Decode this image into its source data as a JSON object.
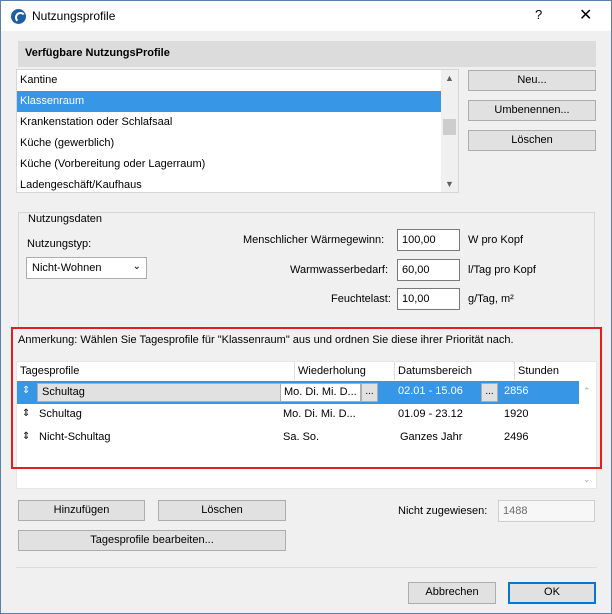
{
  "window": {
    "title": "Nutzungsprofile",
    "help_label": "?",
    "close_label": "✕"
  },
  "profiles": {
    "header": "Verfügbare NutzungsProfile",
    "items": [
      "Kantine",
      "Klassenraum",
      "Krankenstation oder Schlafsaal",
      "Küche (gewerblich)",
      "Küche (Vorbereitung oder Lagerraum)",
      "Ladengeschäft/Kaufhaus"
    ],
    "selected": "Klassenraum",
    "new_label": "Neu...",
    "rename_label": "Umbenennen...",
    "delete_label": "Löschen"
  },
  "usage_data": {
    "legend": "Nutzungsdaten",
    "type_label": "Nutzungstyp:",
    "type_value": "Nicht-Wohnen",
    "heat_gain_label": "Menschlicher Wärmegewinn:",
    "heat_gain_value": "100,00",
    "heat_gain_unit": "W pro Kopf",
    "hot_water_label": "Warmwasserbedarf:",
    "hot_water_value": "60,00",
    "hot_water_unit": "l/Tag pro Kopf",
    "moisture_label": "Feuchtelast:",
    "moisture_value": "10,00",
    "moisture_unit": "g/Tag, m²"
  },
  "day_profiles": {
    "note": "Anmerkung: Wählen Sie Tagesprofile für \"Klassenraum\" aus und ordnen Sie diese ihrer Priorität nach.",
    "columns": [
      "Tagesprofile",
      "Wiederholung",
      "Datumsbereich",
      "Stunden"
    ],
    "rows": [
      {
        "profile": "Schultag",
        "repeat": "Mo. Di. Mi. D...",
        "date_range": "02.01 - 15.06",
        "hours": "2856",
        "selected": true
      },
      {
        "profile": "Schultag",
        "repeat": "Mo. Di. Mi. D...",
        "date_range": "01.09 - 23.12",
        "hours": "1920",
        "selected": false
      },
      {
        "profile": "Nicht-Schultag",
        "repeat": "Sa. So.",
        "date_range": "Ganzes Jahr",
        "hours": "2496",
        "selected": false
      }
    ],
    "dots_label": "...",
    "add_label": "Hinzufügen",
    "delete_label": "Löschen",
    "edit_label": "Tagesprofile bearbeiten...",
    "unassigned_label": "Nicht zugewiesen:",
    "unassigned_value": "1488"
  },
  "footer": {
    "cancel_label": "Abbrechen",
    "ok_label": "OK"
  }
}
